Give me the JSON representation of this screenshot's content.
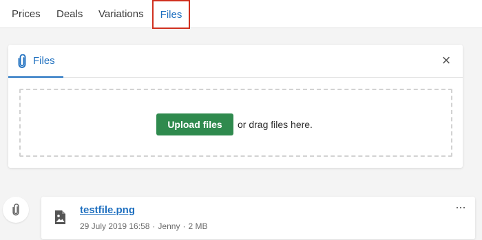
{
  "tabs": [
    {
      "label": "Prices"
    },
    {
      "label": "Deals"
    },
    {
      "label": "Variations"
    },
    {
      "label": "Files"
    }
  ],
  "files_panel": {
    "tab_label": "Files",
    "close_symbol": "×",
    "upload_button_label": "Upload files",
    "drag_text": "or drag files here."
  },
  "file_item": {
    "name": "testfile.png",
    "date": "29 July 2019 16:58",
    "author": "Jenny",
    "size": "2 MB",
    "separator": "·",
    "more_symbol": "···"
  },
  "colors": {
    "accent_blue": "#1e6fbf",
    "upload_green": "#2f8a4e",
    "highlight_red": "#d0301f"
  },
  "icons": [
    "paperclip-icon",
    "close-icon",
    "image-file-icon",
    "more-options-icon"
  ]
}
